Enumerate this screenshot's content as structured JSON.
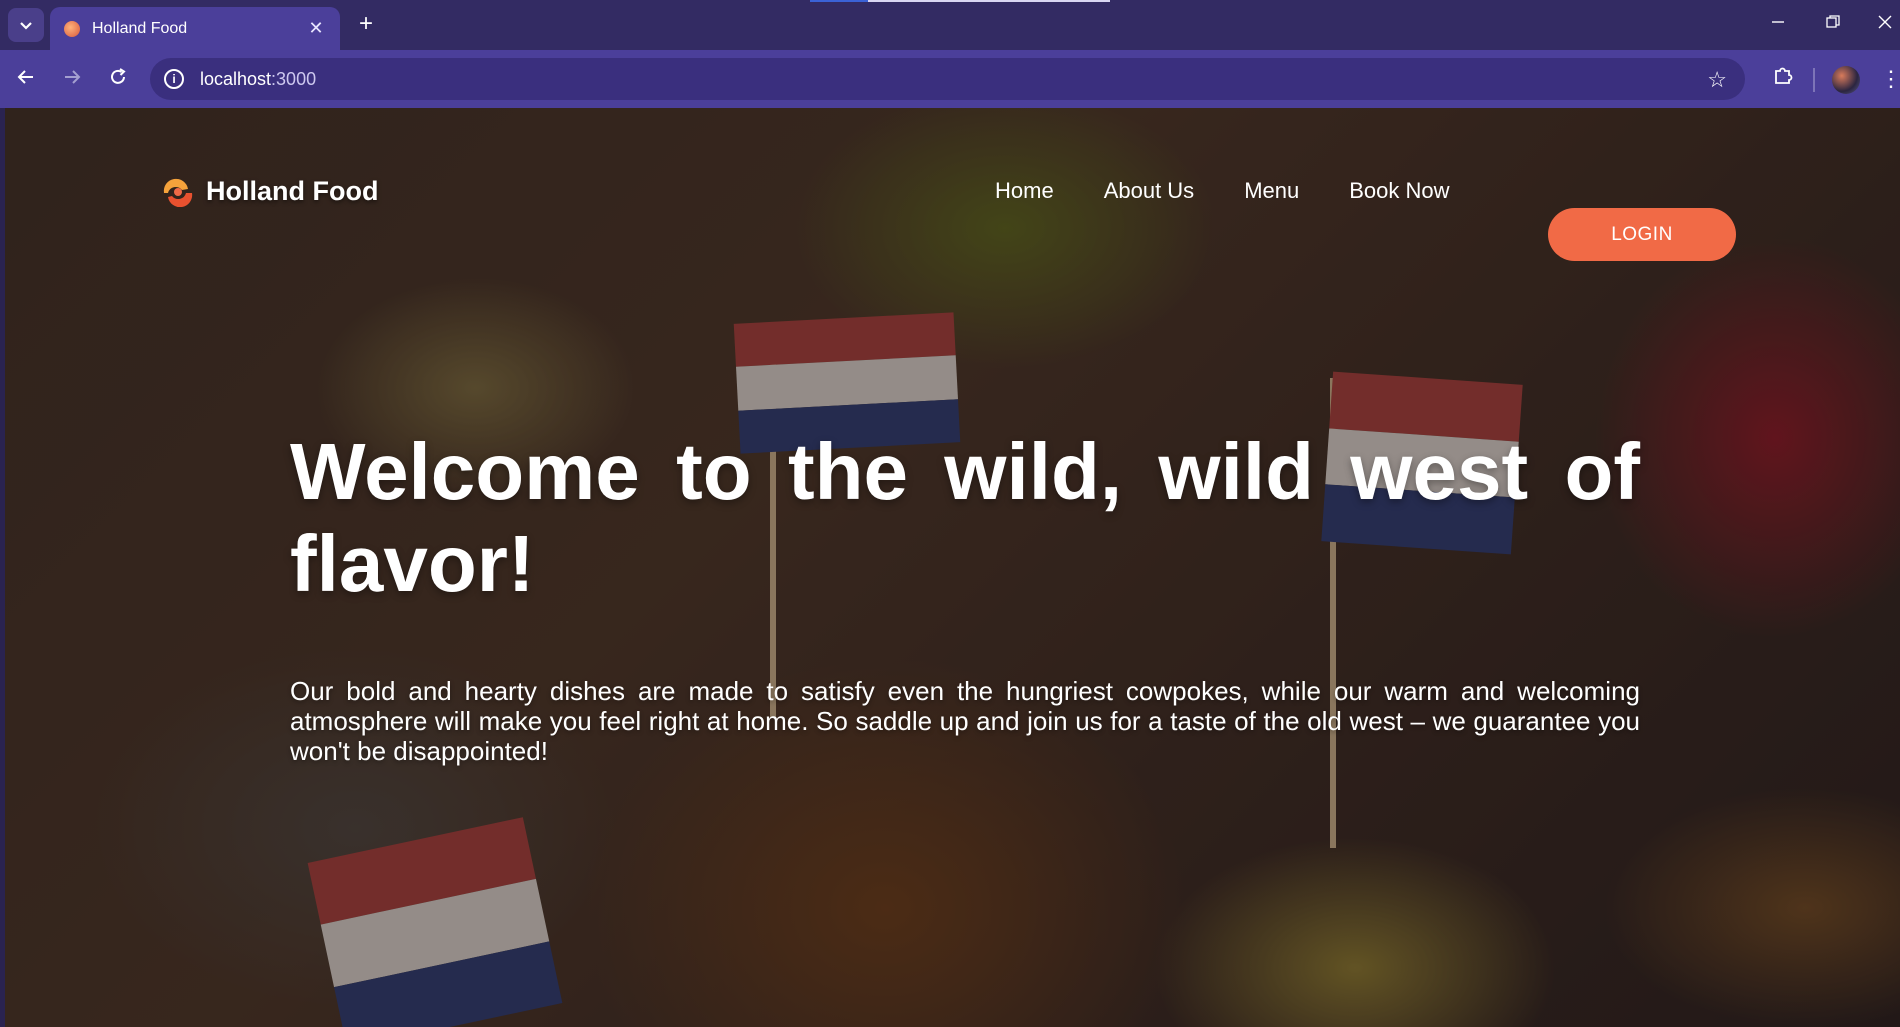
{
  "browser": {
    "tab_title": "Holland Food",
    "url_host": "localhost",
    "url_port": ":3000",
    "new_tab_symbol": "+",
    "close_symbol": "✕"
  },
  "site": {
    "brand": "Holland Food",
    "nav": [
      "Home",
      "About Us",
      "Menu",
      "Book Now"
    ],
    "login_label": "LOGIN",
    "hero_title": "Welcome to the wild, wild west of flavor!",
    "hero_text": "Our bold and hearty dishes are made to satisfy even the hungriest cowpokes, while our warm and welcoming atmosphere will make you feel right at home. So saddle up and join us for a taste of the old west – we guarantee you won't be disappointed!",
    "accent_color": "#f16a46"
  },
  "icons": [
    "chevron-down-icon",
    "close-icon",
    "plus-icon",
    "back-icon",
    "forward-icon",
    "reload-icon",
    "info-icon",
    "star-icon",
    "extensions-icon",
    "avatar",
    "menu-kebab-icon",
    "minimize-icon",
    "restore-icon",
    "window-close-icon",
    "brand-logo-icon"
  ]
}
